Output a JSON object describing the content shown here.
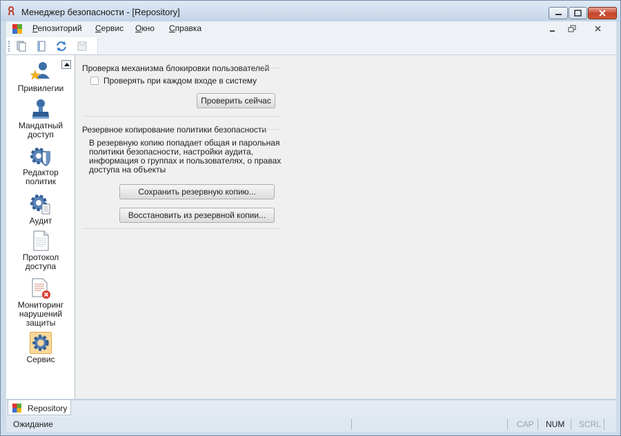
{
  "window": {
    "title": "Менеджер безопасности - [Repository]"
  },
  "menu": {
    "items": [
      {
        "first": "Р",
        "rest": "епозиторий"
      },
      {
        "first": "С",
        "rest": "ервис"
      },
      {
        "first": "О",
        "rest": "кно"
      },
      {
        "first": "С",
        "rest": "правка"
      }
    ]
  },
  "sidebar": {
    "items": [
      {
        "label": "Привилегии",
        "icon": "privileges-icon"
      },
      {
        "label": "Мандатный доступ",
        "icon": "stamp-icon"
      },
      {
        "label": "Редактор политик",
        "icon": "policy-gear-shield-icon"
      },
      {
        "label": "Аудит",
        "icon": "audit-gear-doc-icon"
      },
      {
        "label": "Протокол доступа",
        "icon": "document-icon"
      },
      {
        "label": "Мониторинг нарушений защиты",
        "icon": "violation-doc-icon"
      },
      {
        "label": "Сервис",
        "icon": "service-gear-icon",
        "selected": true
      }
    ]
  },
  "lock_check": {
    "title": "Проверка механизма блокировки пользователей",
    "checkbox_label": "Проверять при каждом входе в систему",
    "checked": false,
    "button": "Проверить сейчас"
  },
  "backup": {
    "title": "Резервное копирование политики безопасности",
    "description": "В резервную копию попадает общая и парольная политики безопасности, настройки аудита, информация о группах и пользователях, о правах доступа на объекты",
    "save_button": "Сохранить резервную копию...",
    "restore_button": "Восстановить из резервной копии..."
  },
  "tabs": [
    {
      "label": "Repository"
    }
  ],
  "status": {
    "text": "Ожидание",
    "cap": "CAP",
    "num": "NUM",
    "scrl": "SCRL"
  },
  "colors": {
    "accent": "#fbd89a",
    "titlebar": "#c3d4e7",
    "close": "#c5462b"
  }
}
